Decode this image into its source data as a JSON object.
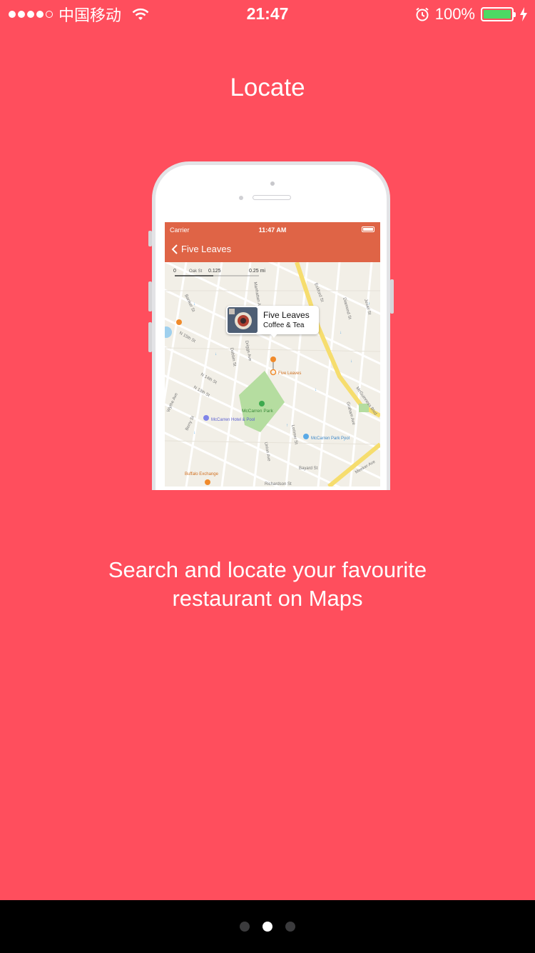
{
  "status_bar": {
    "signal_dots": [
      true,
      true,
      true,
      true,
      false
    ],
    "carrier": "中国移动",
    "time": "21:47",
    "battery_percent": "100%",
    "battery_level": 1.0,
    "icons": [
      "wifi-icon",
      "alarm-icon",
      "battery-icon",
      "charging-bolt-icon"
    ]
  },
  "page": {
    "title": "Locate",
    "caption_line1": "Search and locate your favourite",
    "caption_line2": "restaurant on Maps"
  },
  "phone_screen": {
    "carrier": "Carrier",
    "time": "11:47 AM",
    "back_label": "Five Leaves",
    "callout_title": "Five Leaves",
    "callout_subtitle": "Coffee & Tea",
    "map_labels": {
      "scale_0": "0",
      "scale_1": "0.125",
      "scale_2": "0.25 mi",
      "oak_st": "Oak St",
      "pin": "Five Leaves",
      "park": "McCarren Park",
      "hotel": "McCarren Hotel & Pool",
      "pool": "McCarren Park Pool",
      "buffalo": "Buffalo Exchange",
      "bayard": "Bayard St",
      "richardson": "Richardson St",
      "n14": "N 14th St",
      "n13": "N 13th St",
      "n15": "N 15th St",
      "manhattan": "Manhattan Ave",
      "driggs": "Driggs Ave",
      "banker": "Banker St",
      "eckford": "Eckford St",
      "mcguinness": "McGuinness Blvd",
      "graham": "Graham Ave",
      "lorimer": "Lorimer St",
      "union": "Union Ave",
      "diamond": "Diamond St",
      "jewel": "Jewel St",
      "berry": "Berry St",
      "wythe": "Wythe Ave",
      "meeker": "Meeker Ave",
      "dobbin": "Dobbin St"
    },
    "colors": {
      "nav": "#DF6446",
      "park": "#B5DDA0",
      "pin": "#F08A2A"
    }
  },
  "pager": {
    "count": 3,
    "active_index": 1
  }
}
